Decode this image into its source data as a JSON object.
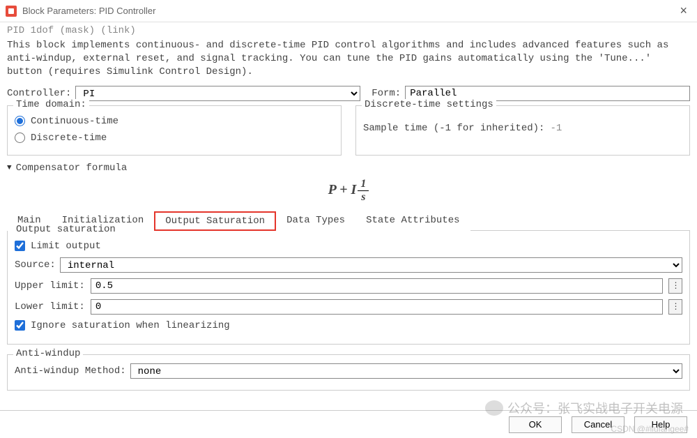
{
  "titlebar": {
    "title": "Block Parameters: PID Controller"
  },
  "mask_line": "PID 1dof (mask) (link)",
  "description": "This block implements continuous- and discrete-time PID control algorithms and includes advanced features such as anti-windup, external reset, and signal tracking. You can tune the PID gains automatically using the 'Tune...' button (requires Simulink Control Design).",
  "controller": {
    "label": "Controller:",
    "value": "PI"
  },
  "form": {
    "label": "Form:",
    "value": "Parallel"
  },
  "time_domain": {
    "legend": "Time domain:",
    "options": {
      "continuous": "Continuous-time",
      "discrete": "Discrete-time"
    },
    "selected": "continuous"
  },
  "discrete_settings": {
    "legend": "Discrete-time settings",
    "sample_label": "Sample time (-1 for inherited):",
    "sample_value": "-1"
  },
  "compensator": {
    "label": "Compensator formula"
  },
  "formula": {
    "P": "P",
    "I": "I",
    "num": "1",
    "den": "s"
  },
  "tabs": {
    "main": "Main",
    "init": "Initialization",
    "out_sat": "Output Saturation",
    "data_types": "Data Types",
    "state_attrs": "State Attributes",
    "active": "out_sat"
  },
  "output_saturation": {
    "legend": "Output saturation",
    "limit_output": {
      "label": "Limit output",
      "checked": true
    },
    "source": {
      "label": "Source:",
      "value": "internal"
    },
    "upper": {
      "label": "Upper limit:",
      "value": "0.5"
    },
    "lower": {
      "label": "Lower limit:",
      "value": "0"
    },
    "ignore_sat": {
      "label": "Ignore saturation when linearizing",
      "checked": true
    }
  },
  "anti_windup": {
    "legend": "Anti-windup",
    "method_label": "Anti-windup Method:",
    "method_value": "none"
  },
  "footer": {
    "ok": "OK",
    "cancel": "Cancel",
    "help": "Help"
  },
  "watermark": "公众号：张飞实战电子开关电源",
  "csdn": "CSDN @#liufangee#"
}
